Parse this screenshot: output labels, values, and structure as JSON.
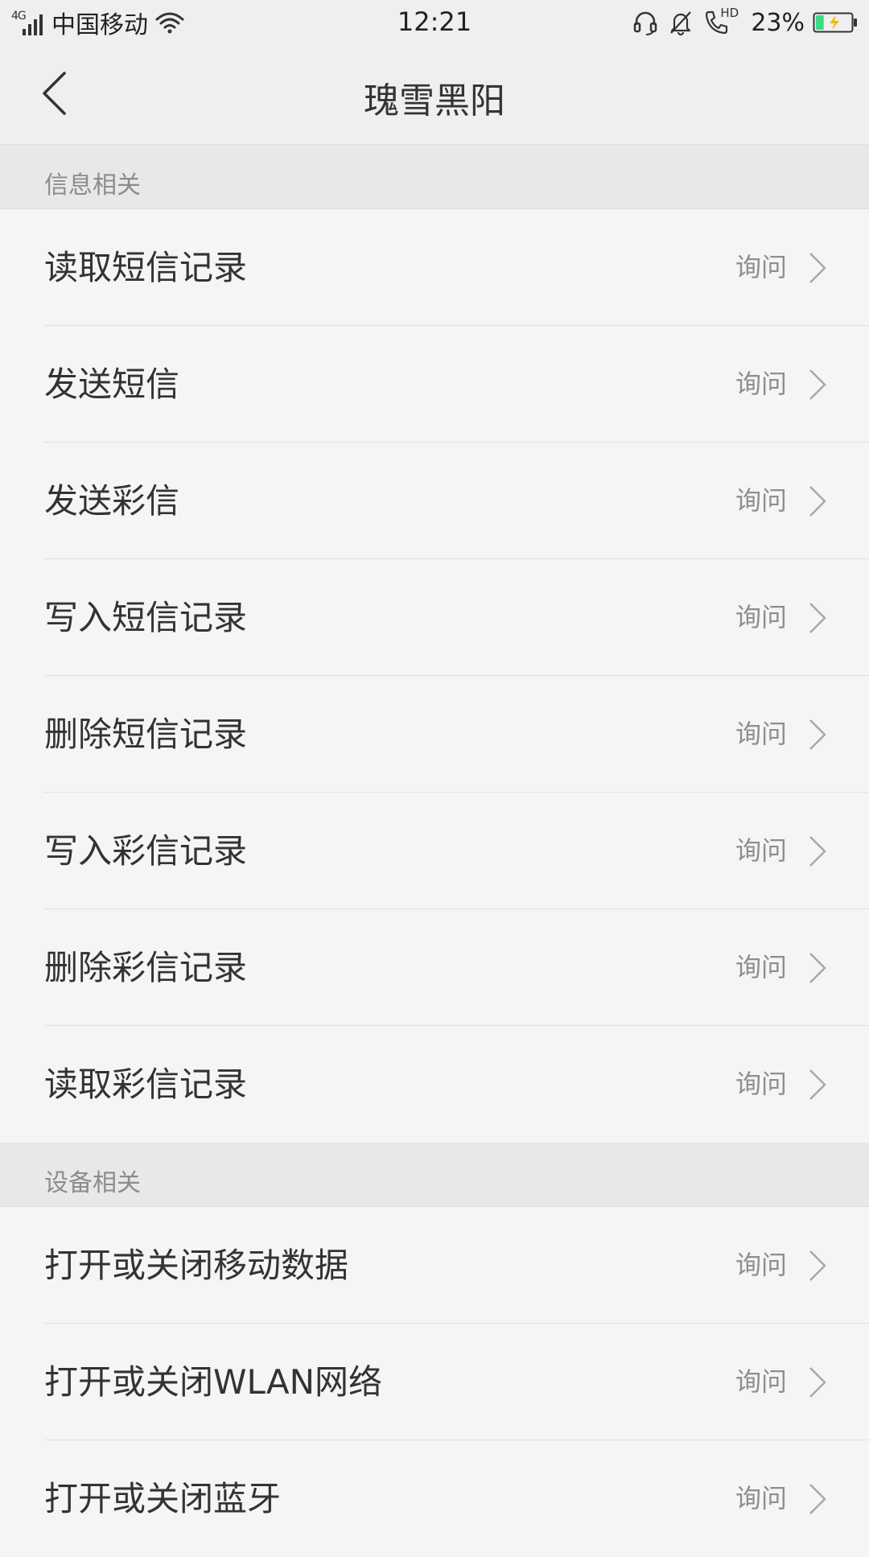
{
  "status_bar": {
    "network_type": "4G",
    "carrier": "中国移动",
    "time": "12:21",
    "hd_label": "HD",
    "battery_percent": "23%",
    "battery_level": 0.23,
    "battery_color": "#3ddc84",
    "icons": [
      "signal-icon",
      "wifi-icon",
      "headset-icon",
      "mute-bell-icon",
      "hd-call-icon",
      "battery-charging-icon"
    ]
  },
  "header": {
    "title": "瑰雪黑阳",
    "back_icon": "chevron-left-icon"
  },
  "sections": [
    {
      "title": "信息相关",
      "items": [
        {
          "label": "读取短信记录",
          "value": "询问"
        },
        {
          "label": "发送短信",
          "value": "询问"
        },
        {
          "label": "发送彩信",
          "value": "询问"
        },
        {
          "label": "写入短信记录",
          "value": "询问"
        },
        {
          "label": "删除短信记录",
          "value": "询问"
        },
        {
          "label": "写入彩信记录",
          "value": "询问"
        },
        {
          "label": "删除彩信记录",
          "value": "询问"
        },
        {
          "label": "读取彩信记录",
          "value": "询问"
        }
      ]
    },
    {
      "title": "设备相关",
      "items": [
        {
          "label": "打开或关闭移动数据",
          "value": "询问"
        },
        {
          "label": "打开或关闭WLAN网络",
          "value": "询问"
        },
        {
          "label": "打开或关闭蓝牙",
          "value": "询问"
        }
      ]
    }
  ]
}
